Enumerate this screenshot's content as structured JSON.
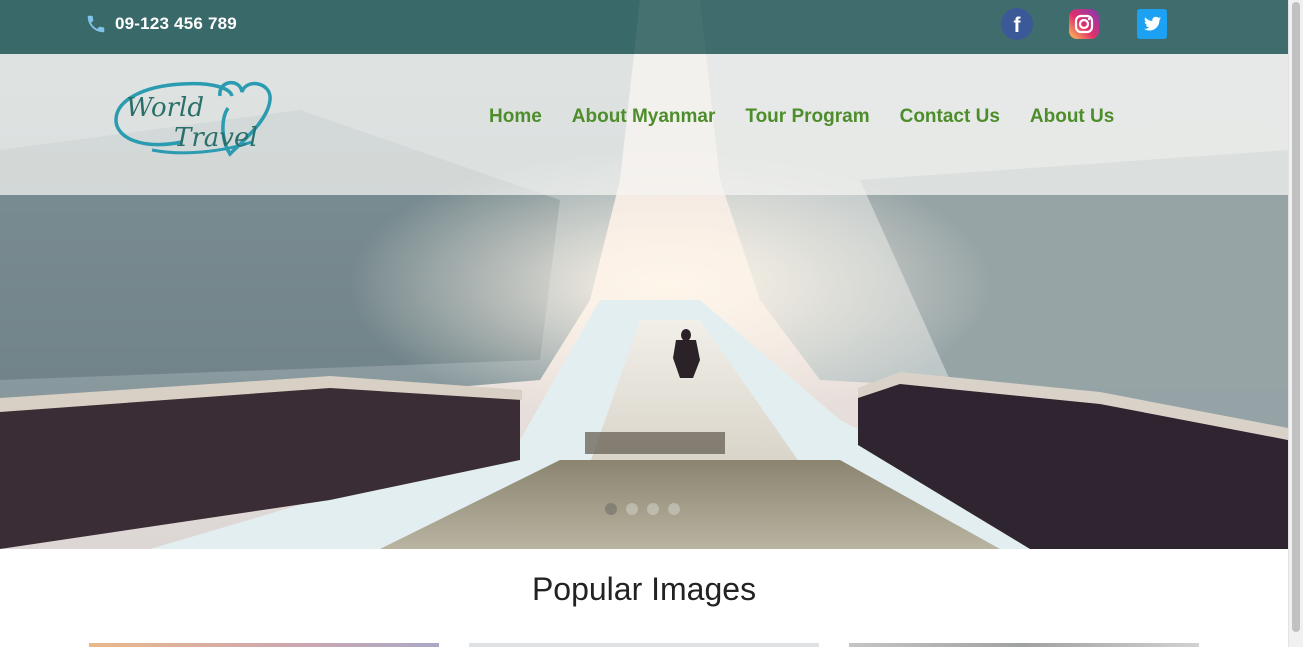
{
  "topbar": {
    "phone": "09-123 456 789",
    "phone_icon": "phone-icon",
    "social": [
      {
        "name": "facebook",
        "icon": "facebook-icon",
        "glyph": "f"
      },
      {
        "name": "instagram",
        "icon": "instagram-icon"
      },
      {
        "name": "twitter",
        "icon": "twitter-icon"
      }
    ]
  },
  "logo": {
    "line1": "World",
    "line2": "Travel"
  },
  "nav": {
    "items": [
      {
        "label": "Home"
      },
      {
        "label": "About Myanmar"
      },
      {
        "label": "Tour Program"
      },
      {
        "label": "Contact Us"
      },
      {
        "label": "About Us"
      }
    ]
  },
  "slider": {
    "slide_count": 4,
    "active_index": 0
  },
  "popular": {
    "title": "Popular Images",
    "thumbnail_count": 3
  },
  "colors": {
    "topbar": "#225858",
    "nav_link": "#4e8d2b",
    "logo": "#2a9bb0",
    "facebook": "#3b5998",
    "twitter": "#1da1f2"
  }
}
